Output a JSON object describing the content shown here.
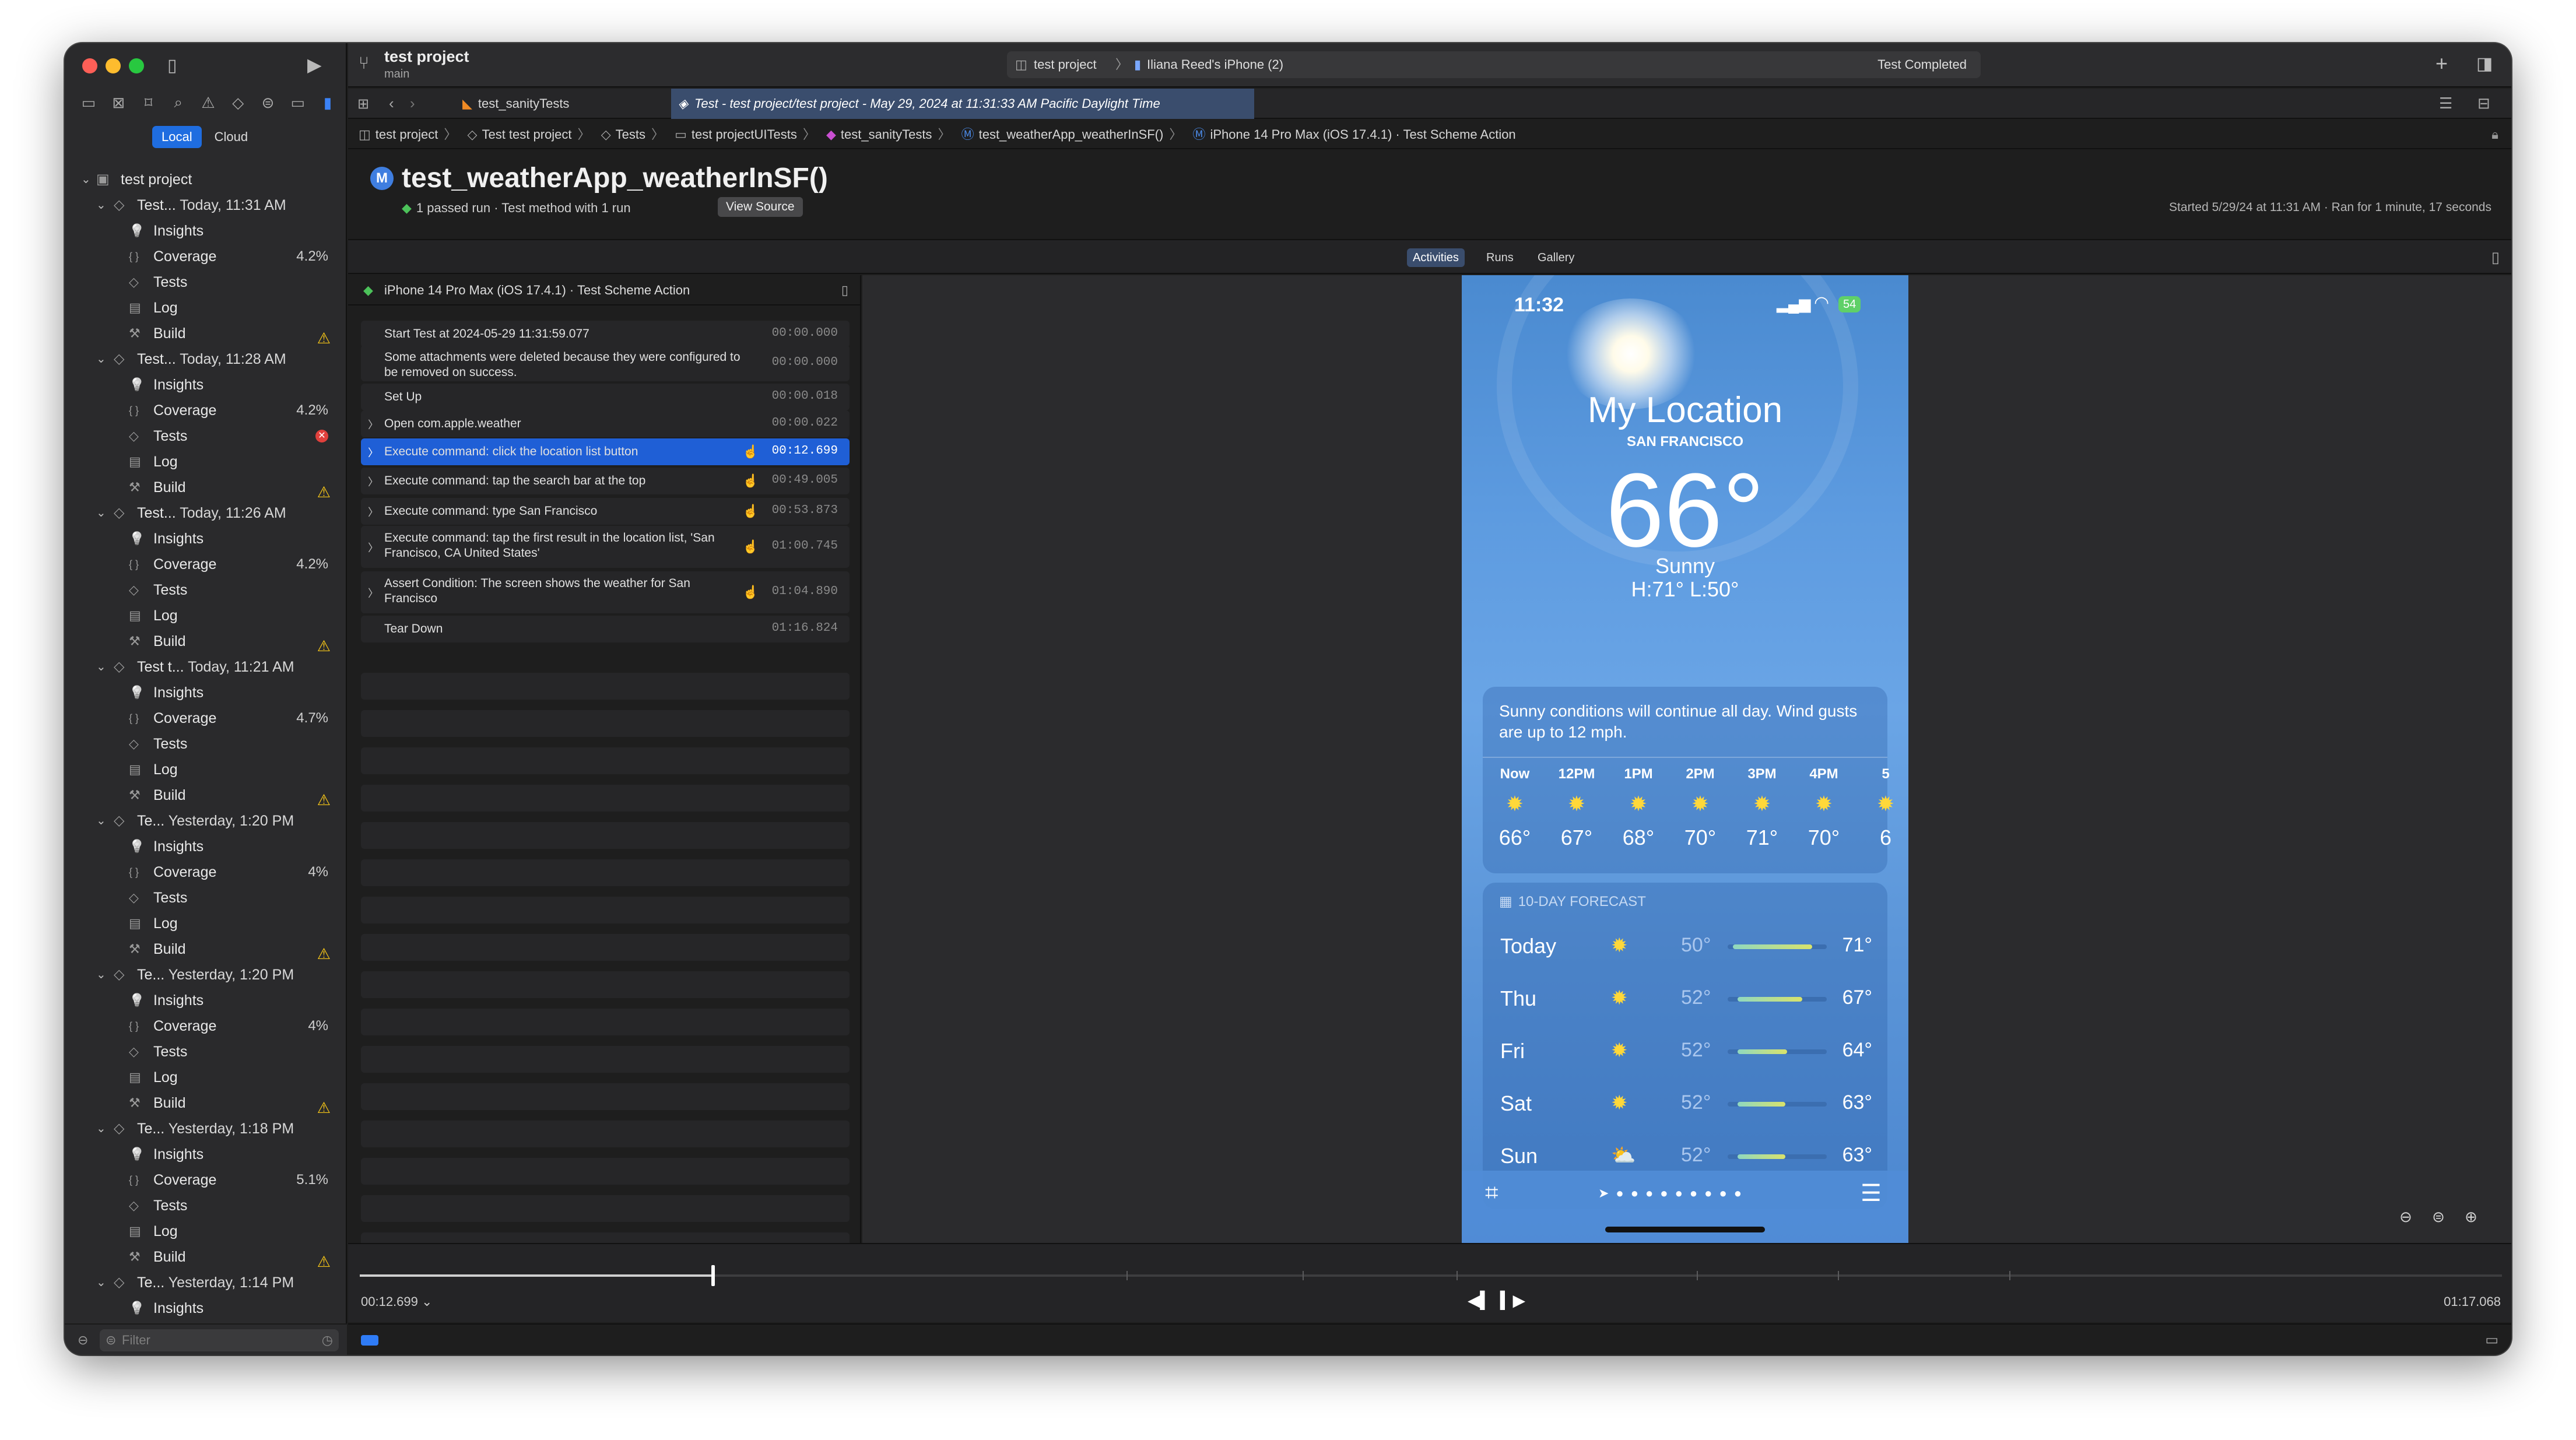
{
  "window": {
    "project": "test project",
    "branch": "main",
    "scheme_breadcrumb": [
      "test project",
      "Iliana Reed's iPhone (2)"
    ],
    "status": "Test Completed"
  },
  "sidebar": {
    "scope_tabs": [
      "Local",
      "Cloud"
    ],
    "root": "test project",
    "runs": [
      {
        "name": "Test...",
        "time": "Today, 11:31 AM",
        "children": [
          {
            "label": "Insights",
            "icon": "lightbulb-icon"
          },
          {
            "label": "Coverage",
            "icon": "braces-icon",
            "value": "4.2%"
          },
          {
            "label": "Tests",
            "icon": "diamond-icon"
          },
          {
            "label": "Log",
            "icon": "document-icon"
          },
          {
            "label": "Build",
            "icon": "hammer-icon",
            "badge": "warning"
          }
        ]
      },
      {
        "name": "Test...",
        "time": "Today, 11:28 AM",
        "children": [
          {
            "label": "Insights",
            "icon": "lightbulb-icon"
          },
          {
            "label": "Coverage",
            "icon": "braces-icon",
            "value": "4.2%"
          },
          {
            "label": "Tests",
            "icon": "diamond-icon",
            "badge": "error"
          },
          {
            "label": "Log",
            "icon": "document-icon"
          },
          {
            "label": "Build",
            "icon": "hammer-icon",
            "badge": "warning"
          }
        ]
      },
      {
        "name": "Test...",
        "time": "Today, 11:26 AM",
        "children": [
          {
            "label": "Insights",
            "icon": "lightbulb-icon"
          },
          {
            "label": "Coverage",
            "icon": "braces-icon",
            "value": "4.2%"
          },
          {
            "label": "Tests",
            "icon": "diamond-icon"
          },
          {
            "label": "Log",
            "icon": "document-icon"
          },
          {
            "label": "Build",
            "icon": "hammer-icon",
            "badge": "warning"
          }
        ]
      },
      {
        "name": "Test t...",
        "time": "Today, 11:21 AM",
        "children": [
          {
            "label": "Insights",
            "icon": "lightbulb-icon"
          },
          {
            "label": "Coverage",
            "icon": "braces-icon",
            "value": "4.7%"
          },
          {
            "label": "Tests",
            "icon": "diamond-icon"
          },
          {
            "label": "Log",
            "icon": "document-icon"
          },
          {
            "label": "Build",
            "icon": "hammer-icon",
            "badge": "warning"
          }
        ]
      },
      {
        "name": "Te...",
        "time": "Yesterday, 1:20 PM",
        "children": [
          {
            "label": "Insights",
            "icon": "lightbulb-icon"
          },
          {
            "label": "Coverage",
            "icon": "braces-icon",
            "value": "4%"
          },
          {
            "label": "Tests",
            "icon": "diamond-icon"
          },
          {
            "label": "Log",
            "icon": "document-icon"
          },
          {
            "label": "Build",
            "icon": "hammer-icon",
            "badge": "warning"
          }
        ]
      },
      {
        "name": "Te...",
        "time": "Yesterday, 1:20 PM",
        "children": [
          {
            "label": "Insights",
            "icon": "lightbulb-icon"
          },
          {
            "label": "Coverage",
            "icon": "braces-icon",
            "value": "4%"
          },
          {
            "label": "Tests",
            "icon": "diamond-icon"
          },
          {
            "label": "Log",
            "icon": "document-icon"
          },
          {
            "label": "Build",
            "icon": "hammer-icon",
            "badge": "warning"
          }
        ]
      },
      {
        "name": "Te...",
        "time": "Yesterday, 1:18 PM",
        "children": [
          {
            "label": "Insights",
            "icon": "lightbulb-icon"
          },
          {
            "label": "Coverage",
            "icon": "braces-icon",
            "value": "5.1%"
          },
          {
            "label": "Tests",
            "icon": "diamond-icon"
          },
          {
            "label": "Log",
            "icon": "document-icon"
          },
          {
            "label": "Build",
            "icon": "hammer-icon",
            "badge": "warning"
          }
        ]
      },
      {
        "name": "Te...",
        "time": "Yesterday, 1:14 PM",
        "children": [
          {
            "label": "Insights",
            "icon": "lightbulb-icon"
          }
        ]
      }
    ],
    "filter_placeholder": "Filter"
  },
  "tabs": {
    "tab1": "test_sanityTests",
    "tab2": "Test - test project/test project - May 29, 2024 at 11:31:33 AM Pacific Daylight Time"
  },
  "jumpbar": [
    "test project",
    "Test test project",
    "Tests",
    "test projectUITests",
    "test_sanityTests",
    "test_weatherApp_weatherInSF()",
    "iPhone 14 Pro Max (iOS 17.4.1) · Test Scheme Action"
  ],
  "header": {
    "title": "test_weatherApp_weatherInSF()",
    "subtitle": "1 passed run · Test method with 1 run",
    "view_source": "View Source",
    "started": "Started 5/29/24 at 11:31 AM · Ran for 1 minute, 17 seconds"
  },
  "view_switch": [
    "Activities",
    "Runs",
    "Gallery"
  ],
  "activities": {
    "device": "iPhone 14 Pro Max (iOS 17.4.1) · Test Scheme Action",
    "rows": [
      {
        "text": "Start Test at 2024-05-29 11:31:59.077",
        "time": "00:00.000"
      },
      {
        "text": "Some attachments were deleted because they were configured to be removed on success.",
        "time": "00:00.000"
      },
      {
        "text": "Set Up",
        "time": "00:00.018"
      },
      {
        "text": "Open com.apple.weather",
        "time": "00:00.022"
      },
      {
        "text": "Execute command: click the location list button",
        "time": "00:12.699"
      },
      {
        "text": "Execute command: tap the search bar at the top",
        "time": "00:49.005"
      },
      {
        "text": "Execute command: type San Francisco",
        "time": "00:53.873"
      },
      {
        "text": "Execute command: tap the first result in the location list, 'San Francisco, CA United States'",
        "time": "01:00.745"
      },
      {
        "text": "Assert Condition: The screen shows the weather for San Francisco",
        "time": "01:04.890"
      },
      {
        "text": "Tear Down",
        "time": "01:16.824"
      }
    ]
  },
  "phone": {
    "clock": "11:32",
    "battery": "54",
    "location": "My Location",
    "city": "SAN FRANCISCO",
    "temp": "66°",
    "condition": "Sunny",
    "hilo": "H:71°  L:50°",
    "summary": "Sunny conditions will continue all day. Wind gusts are up to 12 mph.",
    "hourly": [
      {
        "h": "Now",
        "t": "66°"
      },
      {
        "h": "12PM",
        "t": "67°"
      },
      {
        "h": "1PM",
        "t": "68°"
      },
      {
        "h": "2PM",
        "t": "70°"
      },
      {
        "h": "3PM",
        "t": "71°"
      },
      {
        "h": "4PM",
        "t": "70°"
      },
      {
        "h": "5",
        "t": "6"
      }
    ],
    "forecast_label": "10-DAY FORECAST",
    "days": [
      {
        "d": "Today",
        "lo": "50°",
        "hi": "71°",
        "icon": "sun-icon"
      },
      {
        "d": "Thu",
        "lo": "52°",
        "hi": "67°",
        "icon": "sun-icon"
      },
      {
        "d": "Fri",
        "lo": "52°",
        "hi": "64°",
        "icon": "sun-icon"
      },
      {
        "d": "Sat",
        "lo": "52°",
        "hi": "63°",
        "icon": "sun-icon"
      },
      {
        "d": "Sun",
        "lo": "52°",
        "hi": "63°",
        "icon": "cloud-sun-icon"
      }
    ]
  },
  "timeline": {
    "current": "00:12.699",
    "total": "01:17.068",
    "progress": 0.165
  }
}
